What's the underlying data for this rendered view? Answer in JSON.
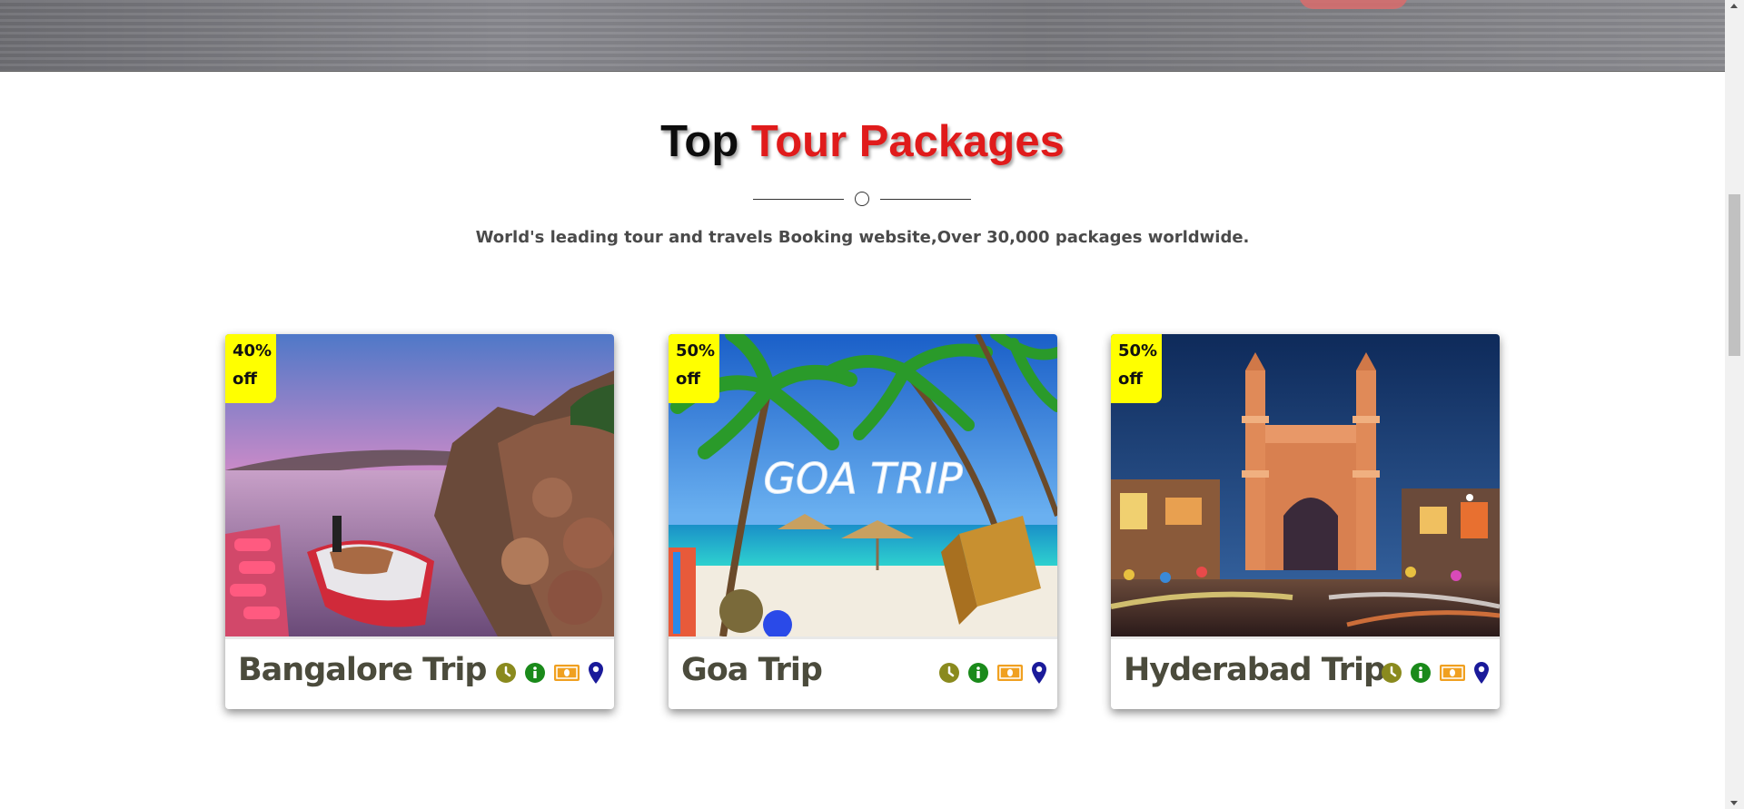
{
  "section": {
    "title_part1": "Top",
    "title_part2": "Tour Packages",
    "subtitle": "World's leading tour and travels Booking website,Over 30,000 packages worldwide."
  },
  "colors": {
    "title_dark": "#0d0d0d",
    "title_red": "#e01b1b",
    "badge": "#ffff00",
    "clock_icon": "#8a8a1e",
    "info_icon": "#1a8a1a",
    "money_icon": "#f0a020",
    "location_icon": "#1a1a9a"
  },
  "packages": [
    {
      "badge_percent": "40%",
      "badge_off": "off",
      "name": "Bangalore Trip",
      "icons": [
        "clock-icon",
        "info-icon",
        "money-icon",
        "location-icon"
      ]
    },
    {
      "badge_percent": "50%",
      "badge_off": "off",
      "name": "Goa Trip",
      "image_text": "GOA TRIP",
      "icons": [
        "clock-icon",
        "info-icon",
        "money-icon",
        "location-icon"
      ]
    },
    {
      "badge_percent": "50%",
      "badge_off": "off",
      "name": "Hyderabad Trip",
      "icons": [
        "clock-icon",
        "info-icon",
        "money-icon",
        "location-icon"
      ]
    }
  ]
}
